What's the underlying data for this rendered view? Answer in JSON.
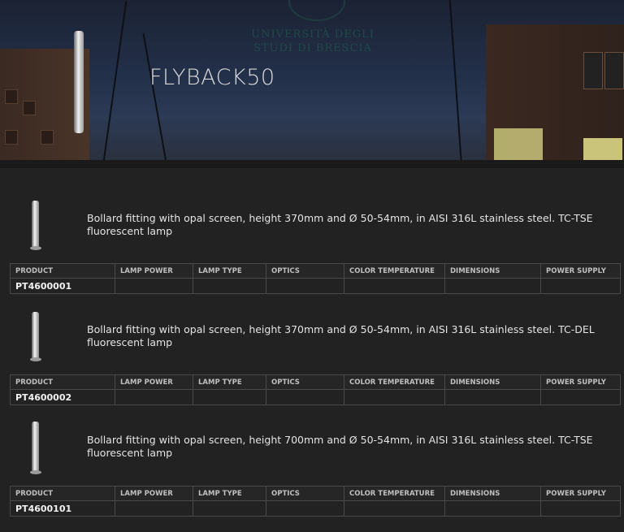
{
  "hero": {
    "title": "FLYBACK50",
    "watermark": [
      "UNIVERSITÀ DEGLI",
      "STUDI DI BRESCIA"
    ]
  },
  "table_headers": [
    "PRODUCT",
    "LAMP POWER",
    "LAMP TYPE",
    "OPTICS",
    "COLOR TEMPERATURE",
    "DIMENSIONS",
    "POWER SUPPLY"
  ],
  "products": [
    {
      "description": "Bollard fitting with opal screen, height 370mm and Ø 50-54mm, in AISI 316L stainless steel. TC-TSE fluorescent lamp",
      "code": "PT4600001",
      "lamp_power": "",
      "lamp_type": "",
      "optics": "",
      "color_temperature": "",
      "dimensions": "",
      "power_supply": ""
    },
    {
      "description": "Bollard fitting with opal screen, height 370mm and Ø 50-54mm, in AISI 316L stainless steel. TC-DEL fluorescent lamp",
      "code": "PT4600002",
      "lamp_power": "",
      "lamp_type": "",
      "optics": "",
      "color_temperature": "",
      "dimensions": "",
      "power_supply": ""
    },
    {
      "description": "Bollard fitting with opal screen, height 700mm and Ø 50-54mm, in AISI 316L stainless steel. TC-TSE fluorescent lamp",
      "code": "PT4600101",
      "lamp_power": "",
      "lamp_type": "",
      "optics": "",
      "color_temperature": "",
      "dimensions": "",
      "power_supply": ""
    }
  ]
}
